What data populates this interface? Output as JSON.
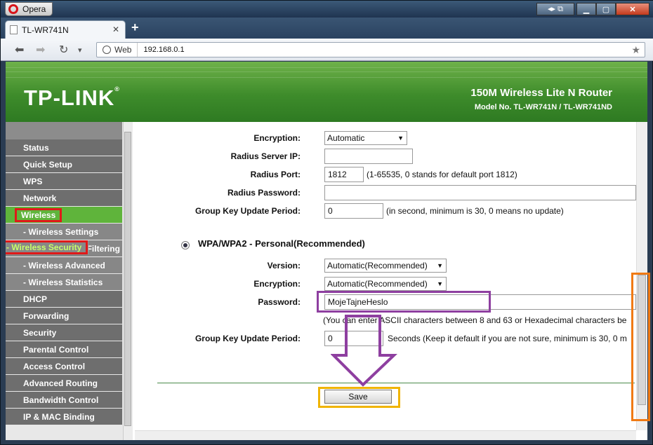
{
  "window": {
    "app_button": "Opera"
  },
  "tab": {
    "title": "TL-WR741N",
    "close": "✕",
    "new_tab": "+"
  },
  "address": {
    "badge": "Web",
    "url": "192.168.0.1"
  },
  "banner": {
    "logo": "TP-LINK",
    "product": "150M Wireless Lite N Router",
    "model": "Model No. TL-WR741N / TL-WR741ND",
    "brand_color": "#4a9a32"
  },
  "sidebar": {
    "items": [
      {
        "label": "Status"
      },
      {
        "label": "Quick Setup"
      },
      {
        "label": "WPS"
      },
      {
        "label": "Network"
      },
      {
        "label": "Wireless"
      },
      {
        "label": "- Wireless Settings"
      },
      {
        "label": "- Wireless Security"
      },
      {
        "label": "- Wireless MAC Filtering"
      },
      {
        "label": "- Wireless Advanced"
      },
      {
        "label": "- Wireless Statistics"
      },
      {
        "label": "DHCP"
      },
      {
        "label": "Forwarding"
      },
      {
        "label": "Security"
      },
      {
        "label": "Parental Control"
      },
      {
        "label": "Access Control"
      },
      {
        "label": "Advanced Routing"
      },
      {
        "label": "Bandwidth Control"
      },
      {
        "label": "IP & MAC Binding"
      }
    ]
  },
  "wpa_enterprise": {
    "encryption_label": "Encryption:",
    "encryption_value": "Automatic",
    "radius_ip_label": "Radius Server IP:",
    "radius_ip_value": "",
    "radius_port_label": "Radius Port:",
    "radius_port_value": "1812",
    "radius_port_hint": "(1-65535, 0 stands for default port 1812)",
    "radius_password_label": "Radius Password:",
    "radius_password_value": "",
    "group_key_label": "Group Key Update Period:",
    "group_key_value": "0",
    "group_key_hint": "(in second, minimum is 30, 0 means no update)"
  },
  "wpa_personal": {
    "title": "WPA/WPA2 - Personal(Recommended)",
    "version_label": "Version:",
    "version_value": "Automatic(Recommended)",
    "encryption_label": "Encryption:",
    "encryption_value": "Automatic(Recommended)",
    "password_label": "Password:",
    "password_value": "MojeTajneHeslo",
    "password_hint": "(You can enter ASCII characters between 8 and 63 or Hexadecimal characters be",
    "group_key_label": "Group Key Update Period:",
    "group_key_value": "0",
    "group_key_hint": "Seconds (Keep it default if you are not sure, minimum is 30, 0 m"
  },
  "save_button": "Save",
  "annotation_colors": {
    "wireless": "#e01919",
    "password": "#8e3fa0",
    "save": "#f0b400",
    "scrollbar": "#f07a14"
  }
}
